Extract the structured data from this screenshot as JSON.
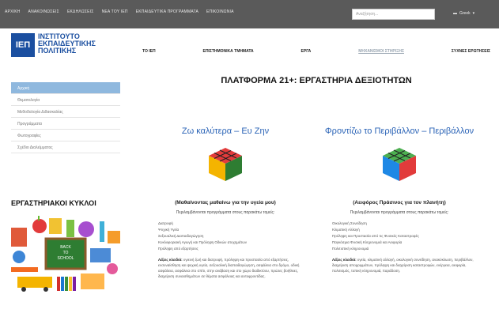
{
  "topbar": {
    "links": [
      "ΑΡΧΙΚΗ",
      "ΑΝΑΚΟΙΝΩΣΕΙΣ",
      "ΕΚΔΗΛΩΣΕΙΣ",
      "ΝΕΑ ΤΟΥ ΙΕΠ",
      "ΕΚΠΑΙΔΕΥΤΙΚΑ ΠΡΟΓΡΑΜΜΑΤΑ",
      "ΕΠΙΚΟΙΝΩΝΙΑ"
    ],
    "search_placeholder": "Αναζήτηση...",
    "language": "Greek"
  },
  "logo": {
    "abbr": "ΙΕΠ",
    "line1": "ΙΝΣΤΙΤΟΥΤΟ",
    "line2": "ΕΚΠΑΙΔΕΥΤΙΚΗΣ",
    "line3": "ΠΟΛΙΤΙΚΗΣ"
  },
  "mainnav": [
    "ΤΟ ΙΕΠ",
    "ΕΠΙΣΤΗΜΟΝΙΚΑ ΤΜΗΜΑΤΑ",
    "ΕΡΓΑ",
    "ΜΗΧΑΝΙΣΜΟΙ ΣΤΗΡΙΞΗΣ",
    "ΣΥΧΝΕΣ ΕΡΩΤΗΣΕΙΣ"
  ],
  "sidebar": [
    "Αρχική",
    "Θεματολογία",
    "Μεθοδολογία Διδασκαλίας",
    "Προγράμματα",
    "Φωτογραφίες",
    "Σχέδιο Διαλείμματος"
  ],
  "workshop_title": "ΕΡΓΑΣΤΗΡΙΑΚΟΙ ΚΥΚΛΟΙ",
  "blackboard_text": {
    "line1": "BACK",
    "line2": "TO",
    "line3": "SCHOOL"
  },
  "page_title": "ΠΛΑΤΦΟΡΜΑ 21+: ΕΡΓΑΣΤΗΡΙΑ ΔΕΞΙΟΤΗΤΩΝ",
  "col1": {
    "title": "Ζω καλύτερα – Ευ Ζην",
    "subtitle": "(Μαθαίνοντας μαθαίνω για την υγεία μου)",
    "lead": "Περιλαμβάνονται προγράμματα στους παρακάτω τομείς:",
    "items": [
      "Διατροφή",
      "Ψυχική Υγεία",
      "Σεξουαλική Διαπαιδαγώγηση",
      "Κυκλοφοριακή Αγωγή και Πρόληψη Οδικών ατυχημάτων",
      "Πρόληψη από εξαρτήσεις"
    ],
    "desc_label": "Λέξεις κλειδιά:",
    "desc": "υγιεινή ζωή και διατροφή, πρόληψη και προστασία από εξαρτήσεις, ενσυναίσθηση και ψυχική υγεία, σεξουαλική διαπαιδαγώγηση, ασφάλεια στο δρόμο, οδική ασφάλεια, ασφάλεια στο σπίτι, στην ανάβαση και στο χώρο διαδικτύου, πρώτες βοήθειες, διαχείριση συναισθημάτων σε θέματα ασφάλειας και αυτοφροντίδας."
  },
  "col2": {
    "title": "Φροντίζω το Περιβάλλον – Περιβάλλον",
    "subtitle": "(Αειφόρος Πράσινος για τον πλανήτη)",
    "lead": "Περιλαμβάνονται προγράμματα στους παρακάτω τομείς:",
    "items": [
      "Οικολογική Συνείδηση",
      "Κλιματική Αλλαγή",
      "Πρόληψη και Προστασία από τις Φυσικές Καταστροφές",
      "Παγκόσμια Φυσική Κληρονομιά και Αειφορία",
      "Πολιτιστική κληρονομιά"
    ],
    "desc_label": "Λέξεις κλειδιά:",
    "desc": "υγεία, κλιματική αλλαγή, οικολογική συνείδηση, ανακύκλωση, περιβάλλον, διαχείριση απορριμμάτων, πρόληψη και διαχείριση καταστροφών, ενέργεια, αειφορία, πολιτισμός, τοπική κληρονομιά, παράδοση."
  }
}
